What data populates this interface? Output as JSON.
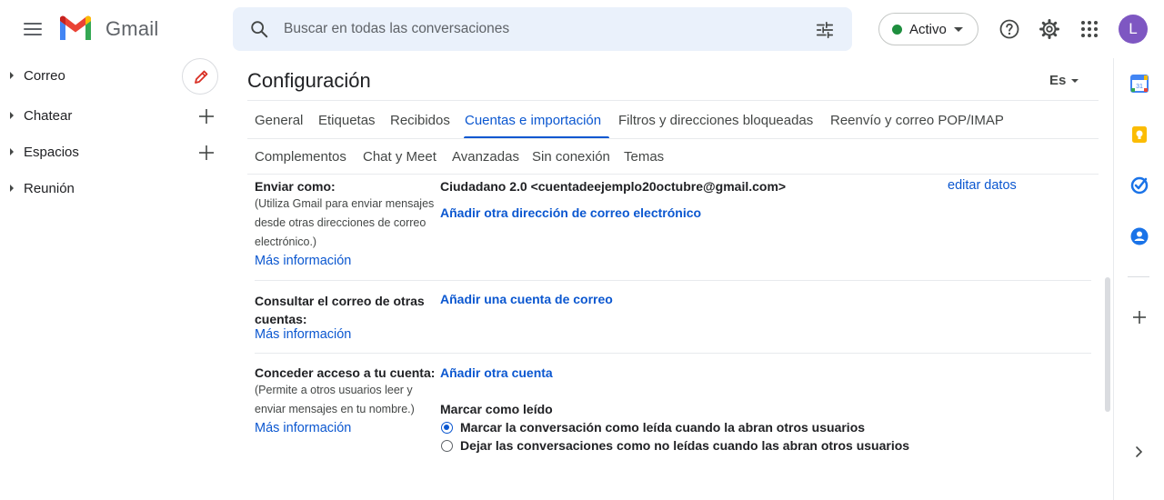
{
  "app": {
    "name": "Gmail"
  },
  "search": {
    "placeholder": "Buscar en todas las conversaciones"
  },
  "status": {
    "label": "Activo",
    "color": "#1e8e3e"
  },
  "account": {
    "avatar_letter": "L",
    "avatar_color": "#7e57c2"
  },
  "icons": {
    "menu": "menu-icon",
    "search": "search-icon",
    "filter": "tune-icon",
    "help": "help-icon",
    "settings": "gear-icon",
    "apps": "apps-grid-icon",
    "compose": "pencil-icon",
    "calendar": "calendar-icon",
    "keep": "keep-icon",
    "tasks": "tasks-icon",
    "contacts": "contacts-icon",
    "add": "plus-icon",
    "expand": "chevron-right-icon"
  },
  "nav": {
    "items": [
      {
        "label": "Correo"
      },
      {
        "label": "Chatear"
      },
      {
        "label": "Espacios"
      },
      {
        "label": "Reunión"
      }
    ]
  },
  "settings": {
    "title": "Configuración",
    "language": "Es",
    "tabs": [
      {
        "label": "General"
      },
      {
        "label": "Etiquetas"
      },
      {
        "label": "Recibidos"
      },
      {
        "label": "Cuentas e importación",
        "active": true
      },
      {
        "label": "Filtros y direcciones bloqueadas"
      },
      {
        "label": "Reenvío y correo POP/IMAP"
      },
      {
        "label": "Complementos"
      },
      {
        "label": "Chat y Meet"
      },
      {
        "label": "Avanzadas"
      },
      {
        "label": "Sin conexión"
      },
      {
        "label": "Temas"
      }
    ],
    "send_as": {
      "label": "Enviar como:",
      "desc_lines": [
        "(Utiliza Gmail para enviar mensajes",
        "desde otras direcciones de correo",
        "electrónico.)"
      ],
      "more_info": "Más información",
      "address": "Ciudadano 2.0 <cuentadeejemplo20octubre@gmail.com>",
      "edit": "editar datos",
      "add_address": "Añadir otra dirección de correo electrónico"
    },
    "check_mail": {
      "label_lines": [
        "Consultar el correo de otras",
        "cuentas:"
      ],
      "more_info": "Más información",
      "add_account": "Añadir una cuenta de correo"
    },
    "grant_access": {
      "label": "Conceder acceso a tu cuenta:",
      "desc_lines": [
        "(Permite a otros usuarios leer y",
        "enviar mensajes en tu nombre.)"
      ],
      "more_info": "Más información",
      "add_another": "Añadir otra cuenta",
      "mark_read_heading": "Marcar como leído",
      "options": [
        {
          "label": "Marcar la conversación como leída cuando la abran otros usuarios",
          "checked": true
        },
        {
          "label": "Dejar las conversaciones como no leídas cuando las abran otros usuarios",
          "checked": false
        }
      ]
    }
  }
}
